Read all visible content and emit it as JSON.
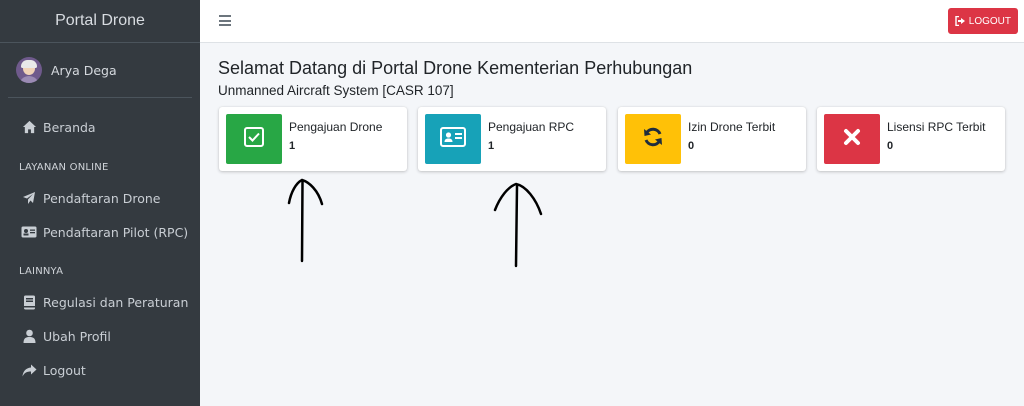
{
  "sidebar": {
    "brand": "Portal Drone",
    "user_name": "Arya Dega",
    "items": [
      {
        "label": "Beranda",
        "icon": "home-icon"
      },
      {
        "label": "Pendaftaran Drone",
        "icon": "paper-plane-icon"
      },
      {
        "label": "Pendaftaran Pilot (RPC)",
        "icon": "id-card-icon"
      },
      {
        "label": "Regulasi dan Peraturan",
        "icon": "book-icon"
      },
      {
        "label": "Ubah Profil",
        "icon": "user-icon"
      },
      {
        "label": "Logout",
        "icon": "share-icon"
      }
    ],
    "headers": [
      "LAYANAN ONLINE",
      "LAINNYA"
    ]
  },
  "topbar": {
    "logout_label": "LOGOUT",
    "menu_icon": "hamburger-icon"
  },
  "main": {
    "title": "Selamat Datang di Portal Drone Kementerian Perhubungan",
    "subtitle": "Unmanned Aircraft System [CASR 107]",
    "cards": [
      {
        "label": "Pengajuan Drone",
        "count": "1",
        "color": "#28a745",
        "icon": "check-square-icon"
      },
      {
        "label": "Pengajuan RPC",
        "count": "1",
        "color": "#17a2b8",
        "icon": "id-card-icon"
      },
      {
        "label": "Izin Drone Terbit",
        "count": "0",
        "color": "#ffc107",
        "icon": "sync-icon"
      },
      {
        "label": "Lisensi RPC Terbit",
        "count": "0",
        "color": "#dc3545",
        "icon": "times-icon"
      }
    ]
  },
  "colors": {
    "sidebar_bg": "#343a40",
    "logout_bg": "#dc3545"
  }
}
